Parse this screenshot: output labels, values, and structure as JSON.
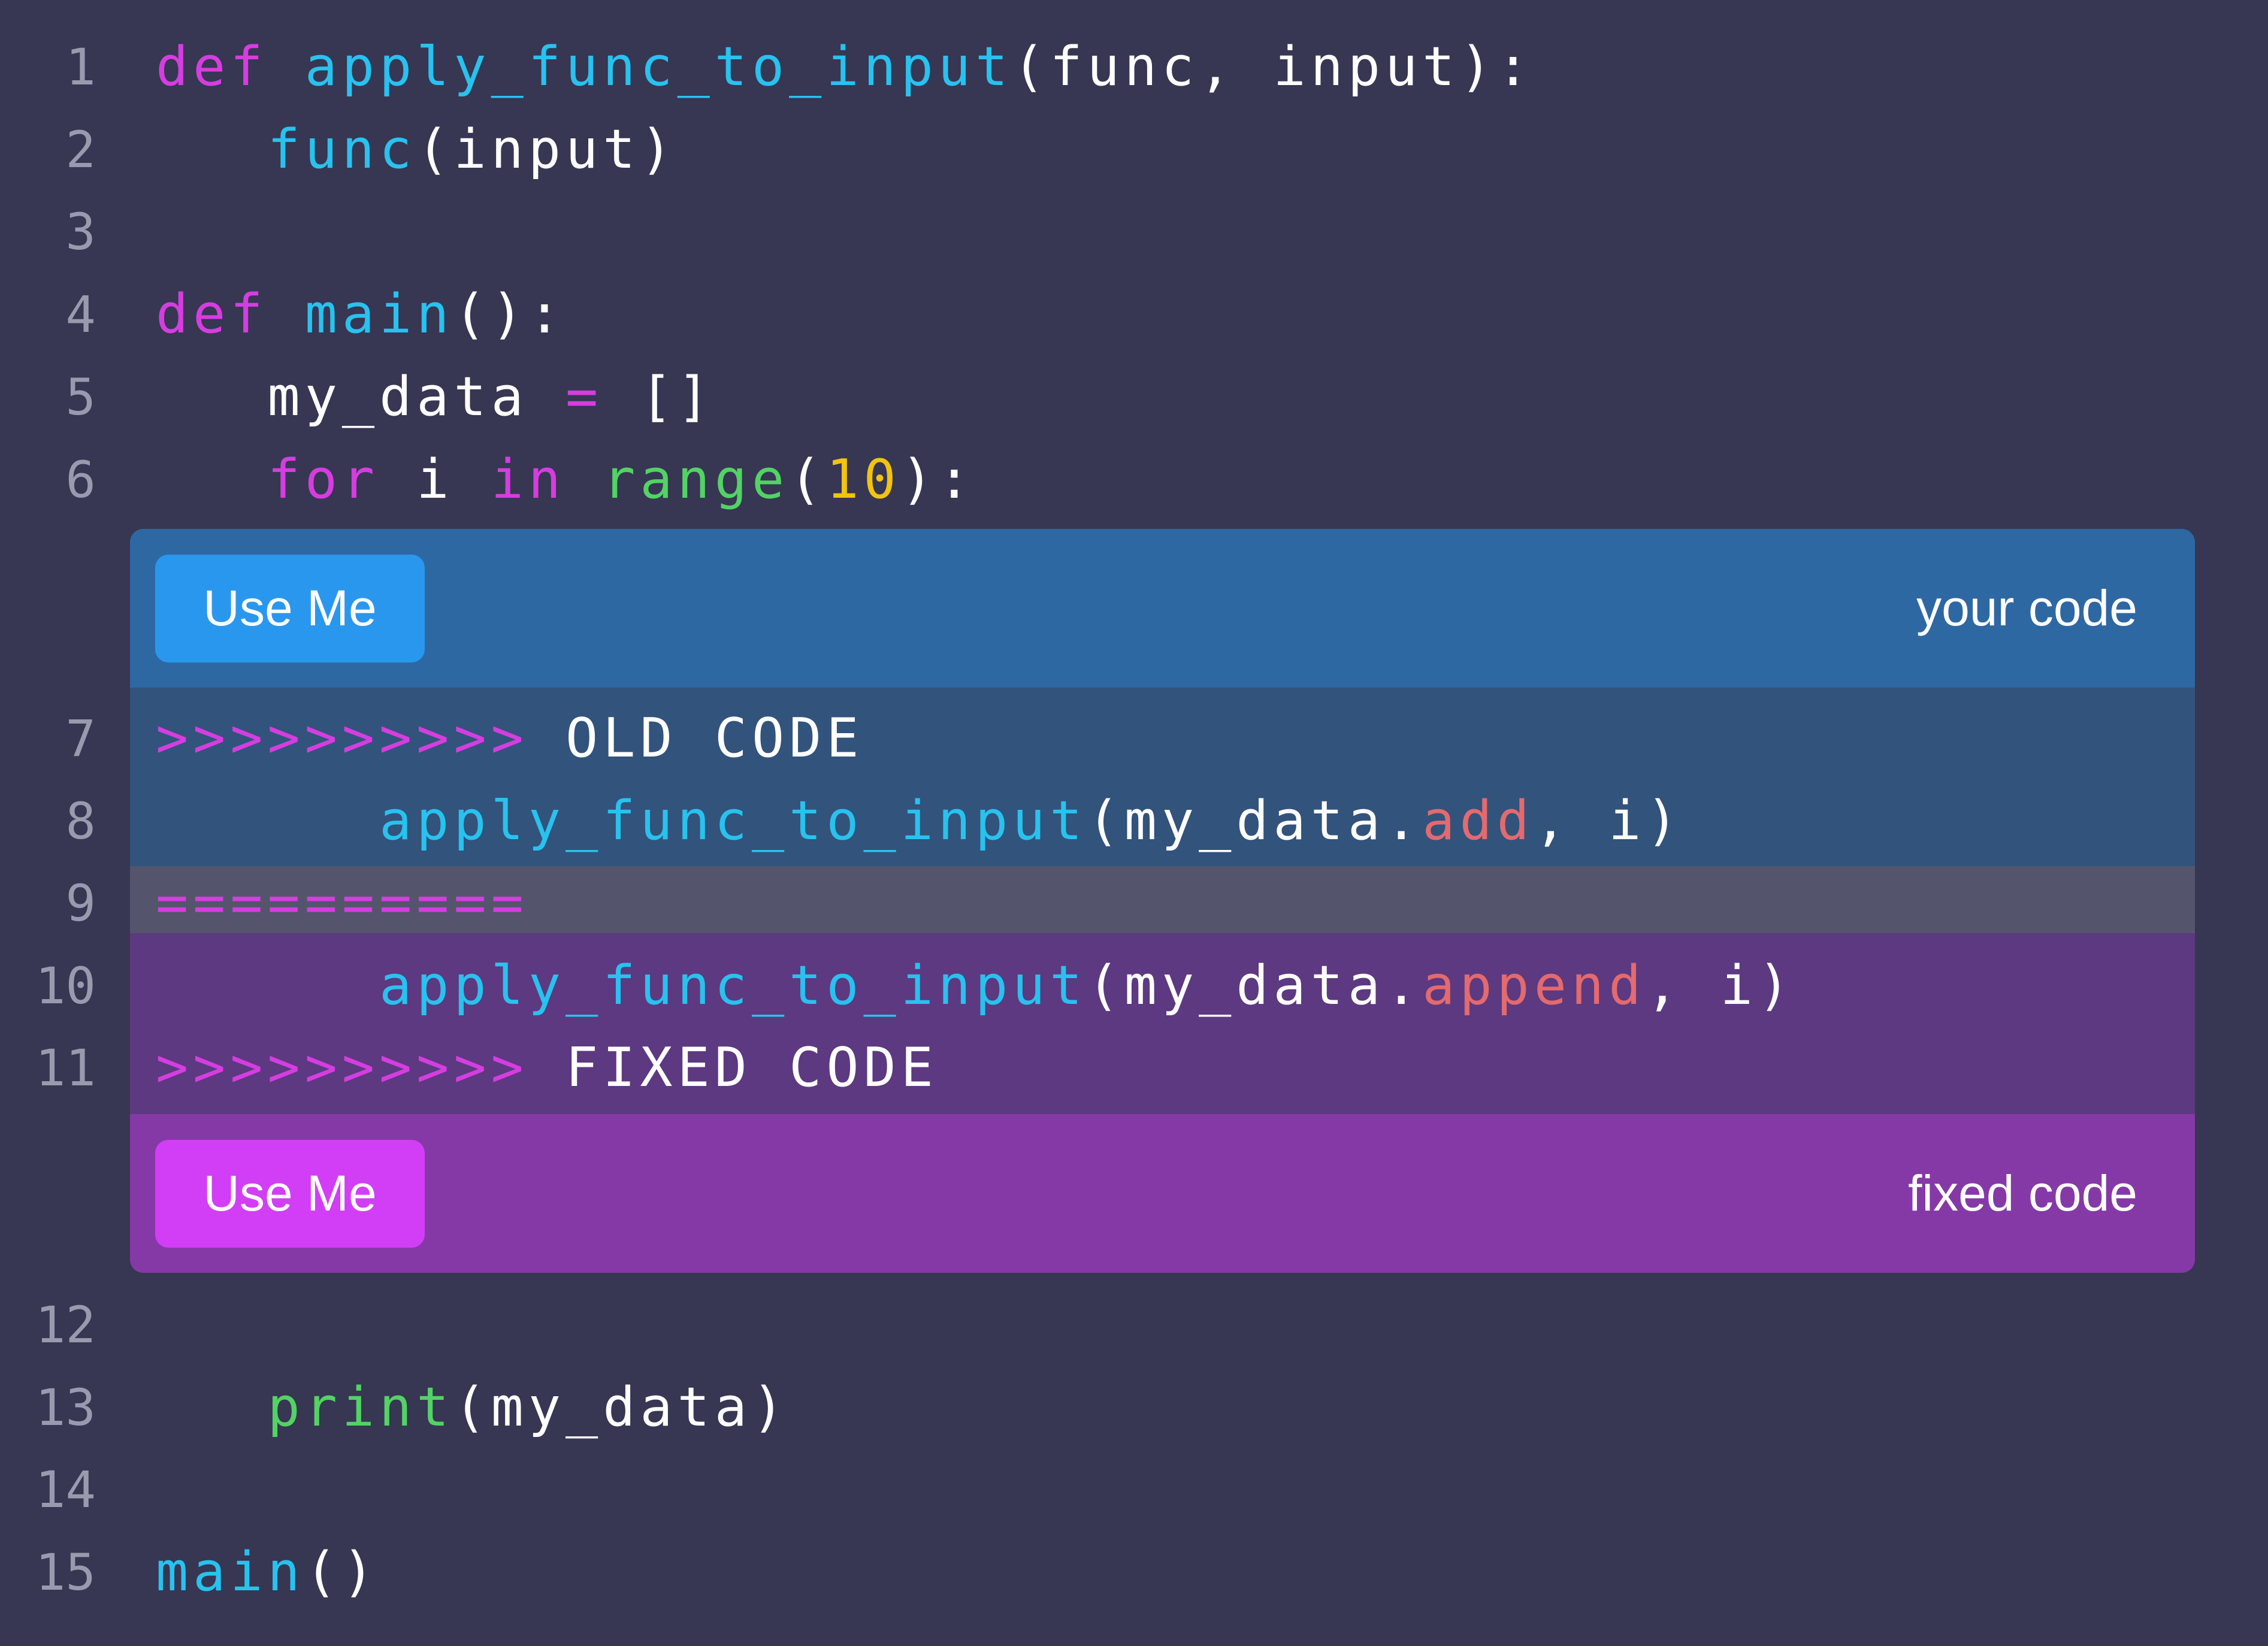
{
  "colors": {
    "background": "#373653",
    "line_number": "#9a9aae",
    "plain": "#ffffff",
    "keyword": "#d63de0",
    "function": "#28c2ef",
    "builtin": "#52d364",
    "number": "#f1c40f",
    "attribute": "#e36a6f",
    "marker": "#d63de0",
    "current_header_bg": "#2e68a3",
    "current_block_bg": "#32537b",
    "separator_bg": "#55546d",
    "incoming_block_bg": "#5c3980",
    "incoming_header_bg": "#8539a6",
    "current_button_bg": "#2a97ef",
    "incoming_button_bg": "#d23ef5"
  },
  "lines": [
    {
      "num": "1",
      "tokens": [
        {
          "t": "def",
          "c": "keyword"
        },
        {
          "t": " ",
          "c": "plain"
        },
        {
          "t": "apply_func_to_input",
          "c": "function"
        },
        {
          "t": "(func, input):",
          "c": "plain"
        }
      ]
    },
    {
      "num": "2",
      "tokens": [
        {
          "t": "   ",
          "c": "plain"
        },
        {
          "t": "func",
          "c": "function"
        },
        {
          "t": "(input)",
          "c": "plain"
        }
      ]
    },
    {
      "num": "3",
      "tokens": []
    },
    {
      "num": "4",
      "tokens": [
        {
          "t": "def",
          "c": "keyword"
        },
        {
          "t": " ",
          "c": "plain"
        },
        {
          "t": "main",
          "c": "function"
        },
        {
          "t": "():",
          "c": "plain"
        }
      ]
    },
    {
      "num": "5",
      "tokens": [
        {
          "t": "   my_data ",
          "c": "plain"
        },
        {
          "t": "=",
          "c": "keyword"
        },
        {
          "t": " []",
          "c": "plain"
        }
      ]
    },
    {
      "num": "6",
      "tokens": [
        {
          "t": "   ",
          "c": "plain"
        },
        {
          "t": "for",
          "c": "keyword"
        },
        {
          "t": " i ",
          "c": "plain"
        },
        {
          "t": "in",
          "c": "keyword"
        },
        {
          "t": " ",
          "c": "plain"
        },
        {
          "t": "range",
          "c": "builtin"
        },
        {
          "t": "(",
          "c": "plain"
        },
        {
          "t": "10",
          "c": "number"
        },
        {
          "t": "):",
          "c": "plain"
        }
      ]
    },
    {
      "num": "7",
      "tokens": [
        {
          "t": ">>>>>>>>>>",
          "c": "marker"
        },
        {
          "t": " OLD CODE",
          "c": "plain"
        }
      ]
    },
    {
      "num": "8",
      "tokens": [
        {
          "t": "      ",
          "c": "plain"
        },
        {
          "t": "apply_func_to_input",
          "c": "function"
        },
        {
          "t": "(my_data.",
          "c": "plain"
        },
        {
          "t": "add",
          "c": "attribute"
        },
        {
          "t": ", i)",
          "c": "plain"
        }
      ]
    },
    {
      "num": "9",
      "tokens": [
        {
          "t": "==========",
          "c": "marker"
        }
      ]
    },
    {
      "num": "10",
      "tokens": [
        {
          "t": "      ",
          "c": "plain"
        },
        {
          "t": "apply_func_to_input",
          "c": "function"
        },
        {
          "t": "(my_data.",
          "c": "plain"
        },
        {
          "t": "append",
          "c": "attribute"
        },
        {
          "t": ", i)",
          "c": "plain"
        }
      ]
    },
    {
      "num": "11",
      "tokens": [
        {
          "t": ">>>>>>>>>>",
          "c": "marker"
        },
        {
          "t": " FIXED CODE",
          "c": "plain"
        }
      ]
    },
    {
      "num": "12",
      "tokens": []
    },
    {
      "num": "13",
      "tokens": [
        {
          "t": "   ",
          "c": "plain"
        },
        {
          "t": "print",
          "c": "builtin"
        },
        {
          "t": "(my_data)",
          "c": "plain"
        }
      ]
    },
    {
      "num": "14",
      "tokens": []
    },
    {
      "num": "15",
      "tokens": [
        {
          "t": "main",
          "c": "function"
        },
        {
          "t": "()",
          "c": "plain"
        }
      ]
    }
  ],
  "current_header": {
    "button_label": "Use Me",
    "label": "your code"
  },
  "incoming_header": {
    "button_label": "Use Me",
    "label": "fixed code"
  }
}
